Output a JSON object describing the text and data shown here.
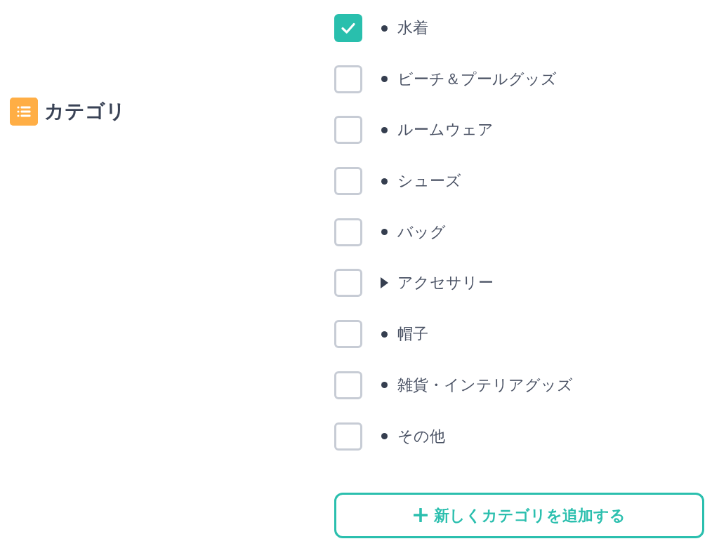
{
  "section": {
    "title": "カテゴリ"
  },
  "categories": [
    {
      "label": "水着",
      "kind": "leaf",
      "checked": true
    },
    {
      "label": "ビーチ＆プールグッズ",
      "kind": "leaf",
      "checked": false
    },
    {
      "label": "ルームウェア",
      "kind": "leaf",
      "checked": false
    },
    {
      "label": "シューズ",
      "kind": "leaf",
      "checked": false
    },
    {
      "label": "バッグ",
      "kind": "leaf",
      "checked": false
    },
    {
      "label": "アクセサリー",
      "kind": "branch",
      "expanded": false,
      "checked": false
    },
    {
      "label": "帽子",
      "kind": "leaf",
      "checked": false
    },
    {
      "label": "雑貨・インテリアグッズ",
      "kind": "leaf",
      "checked": false
    },
    {
      "label": "その他",
      "kind": "leaf",
      "checked": false
    }
  ],
  "add_button": {
    "label": "新しくカテゴリを追加する"
  }
}
